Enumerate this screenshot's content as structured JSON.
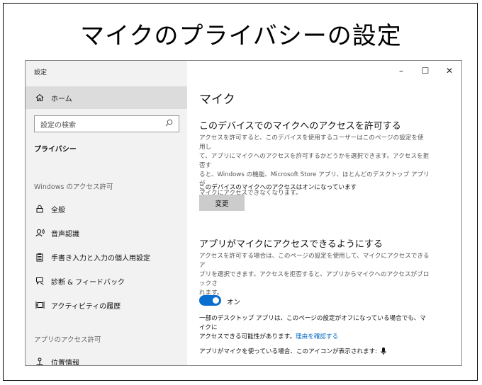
{
  "slide_title": "マイクのプライバシーの設定",
  "window": {
    "title": "設定",
    "controls": {
      "minimize": "–",
      "maximize": "☐",
      "close": "✕"
    }
  },
  "sidebar": {
    "home": "ホーム",
    "search_placeholder": "設定の検索",
    "section": "プライバシー",
    "group1": "Windows のアクセス許可",
    "items": [
      {
        "label": "全般",
        "icon": "lock-icon"
      },
      {
        "label": "音声認識",
        "icon": "speech-icon"
      },
      {
        "label": "手書き入力と入力の個人用設定",
        "icon": "clipboard-icon"
      },
      {
        "label": "診断 & フィードバック",
        "icon": "feedback-icon"
      },
      {
        "label": "アクティビティの履歴",
        "icon": "timeline-icon"
      }
    ],
    "group2": "アプリのアクセス許可",
    "items2": [
      {
        "label": "位置情報",
        "icon": "location-icon"
      }
    ]
  },
  "main": {
    "title": "マイク",
    "section1": {
      "heading": "このデバイスでのマイクへのアクセスを許可する",
      "lines": [
        "アクセスを許可すると、このデバイスを使用するユーザーはこのページの設定を使用し",
        "て、アプリにマイクへのアクセスを許可するかどうかを選択できます。アクセスを拒否す",
        "ると、Windows の機能、Microsoft Store アプリ、ほとんどのデスクトップ アプリが",
        "マイクにアクセスできなくなります。"
      ],
      "status": "このデバイスのマイクへのアクセスはオンになっています",
      "button": "変更"
    },
    "section2": {
      "heading": "アプリがマイクにアクセスできるようにする",
      "lines": [
        "アクセスを許可する場合は、このページの設定を使用して、マイクにアクセスできるア",
        "プリを選択できます。アクセスを拒否すると、アプリからマイクへのアクセスがブロックさ",
        "れます。"
      ],
      "toggle_on": true,
      "toggle_label": "オン",
      "note_lines": [
        "一部のデスクトップ アプリは、このページの設定がオフになっている場合でも、マイクに",
        "アクセスできる可能性があります。"
      ],
      "note_link": "理由を確認する",
      "footer": "アプリがマイクを使っている場合、このアイコンが表示されます:"
    }
  }
}
